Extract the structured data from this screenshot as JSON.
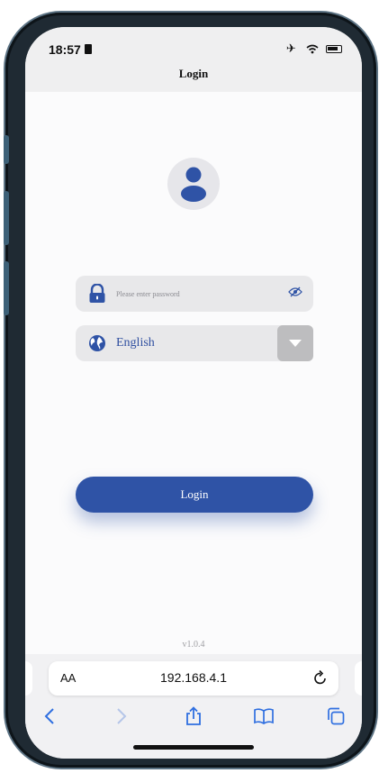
{
  "status_bar": {
    "time": "18:57",
    "icons": [
      "sim-card-icon",
      "airplane-icon",
      "wifi-icon",
      "battery-icon"
    ]
  },
  "nav": {
    "title": "Login"
  },
  "avatar": {
    "icon": "user-icon"
  },
  "password_field": {
    "placeholder": "Please enter password",
    "value": "",
    "icon": "lock-icon",
    "toggle_icon": "eye-off-icon"
  },
  "language_select": {
    "value": "English",
    "icon": "globe-icon",
    "dropdown_icon": "caret-down-icon"
  },
  "login_button": {
    "label": "Login"
  },
  "version": "v1.0.4",
  "browser": {
    "text_size_label": "AA",
    "url": "192.168.4.1",
    "toolbar_icons": [
      "back-icon",
      "forward-icon",
      "share-icon",
      "bookmarks-icon",
      "tabs-icon"
    ]
  },
  "colors": {
    "accent": "#2f53a6",
    "field_background": "#e8e8ea",
    "dropdown_background": "#bdbdbf"
  }
}
